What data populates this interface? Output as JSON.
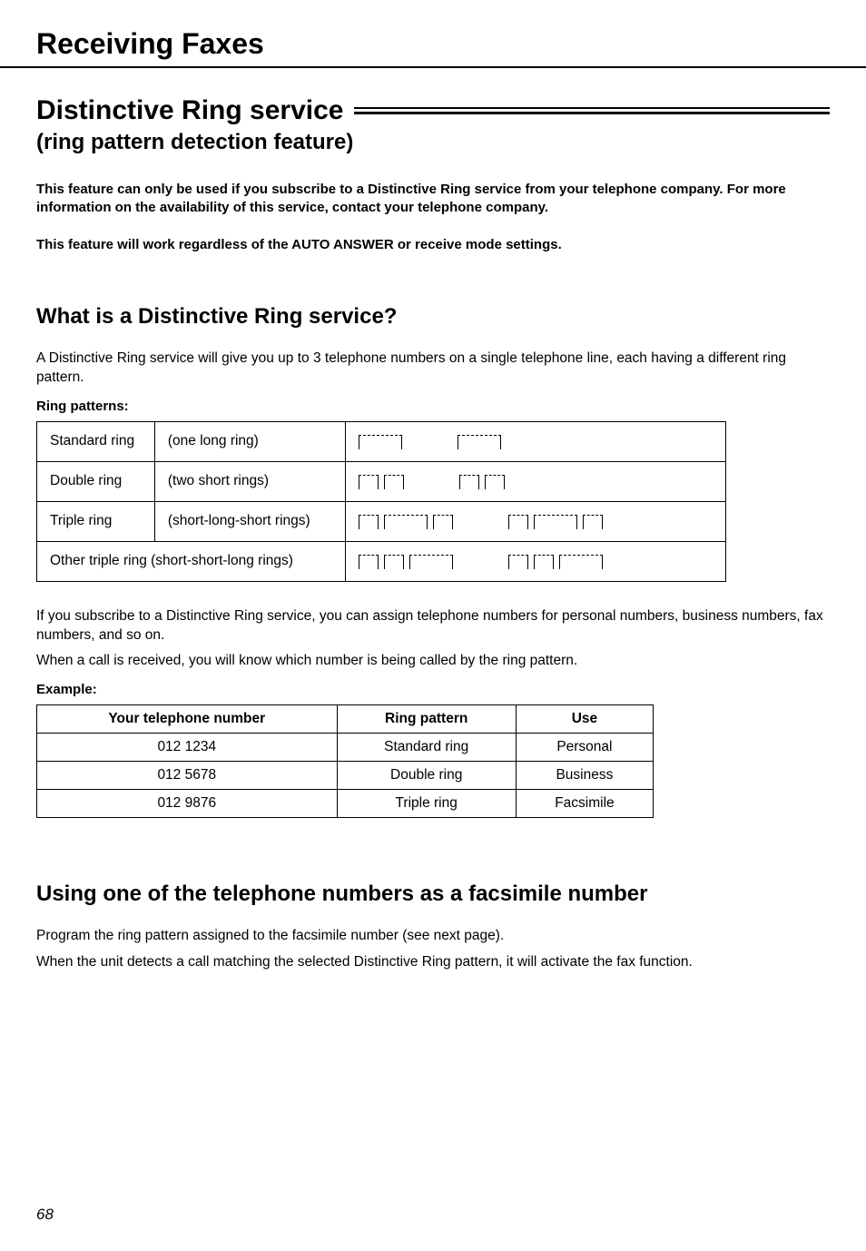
{
  "header": "Receiving Faxes",
  "title": "Distinctive Ring service",
  "subtitle": "(ring pattern detection feature)",
  "intro1": "This feature can only be used if you subscribe to a Distinctive Ring service from your telephone company. For more information on the availability of this service, contact your telephone company.",
  "intro2": "This feature will work regardless of the AUTO ANSWER or receive mode settings.",
  "what_heading": "What is a Distinctive Ring service?",
  "what_body": "A Distinctive Ring service will give you up to 3 telephone numbers on a single telephone line, each having a different ring pattern.",
  "ring_patterns_label": "Ring patterns:",
  "ring_rows": [
    {
      "name": "Standard ring",
      "desc": "(one long ring)",
      "pattern": [
        "long"
      ]
    },
    {
      "name": "Double ring",
      "desc": "(two short rings)",
      "pattern": [
        "short",
        "short"
      ]
    },
    {
      "name": "Triple ring",
      "desc": "(short-long-short rings)",
      "pattern": [
        "short",
        "long",
        "short"
      ]
    },
    {
      "name": "Other triple ring",
      "desc": "(short-short-long rings)",
      "pattern": [
        "short",
        "short",
        "long"
      ]
    }
  ],
  "assign_body1": "If you subscribe to a Distinctive Ring service, you can assign telephone numbers for personal numbers, business numbers, fax numbers, and so on.",
  "assign_body2": "When a call is received, you will know which number is being called by the ring pattern.",
  "example_label": "Example:",
  "example_headers": [
    "Your telephone number",
    "Ring pattern",
    "Use"
  ],
  "example_rows": [
    [
      "012 1234",
      "Standard ring",
      "Personal"
    ],
    [
      "012 5678",
      "Double ring",
      "Business"
    ],
    [
      "012 9876",
      "Triple ring",
      "Facsimile"
    ]
  ],
  "using_heading": "Using one of the telephone numbers as a facsimile number",
  "using_body1": "Program the ring pattern assigned to the facsimile number (see next page).",
  "using_body2": "When the unit detects a call matching the selected Distinctive Ring pattern, it will activate the fax function.",
  "page_number": "68"
}
